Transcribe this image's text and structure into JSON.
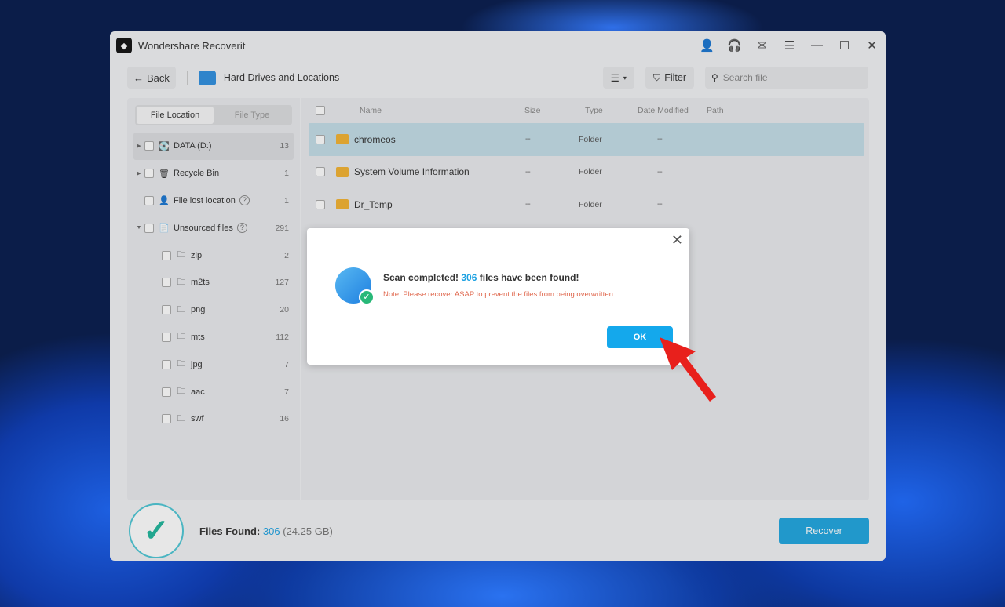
{
  "window": {
    "title": "Wondershare Recoverit"
  },
  "toolbar": {
    "back": "Back",
    "location": "Hard Drives and Locations",
    "filter": "Filter",
    "search_placeholder": "Search file"
  },
  "tabs": {
    "file_location": "File Location",
    "file_type": "File Type"
  },
  "tree": [
    {
      "label": "DATA (D:)",
      "count": "13"
    },
    {
      "label": "Recycle Bin",
      "count": "1"
    },
    {
      "label": "File lost location",
      "count": "1"
    },
    {
      "label": "Unsourced files",
      "count": "291"
    },
    {
      "label": "zip",
      "count": "2"
    },
    {
      "label": "m2ts",
      "count": "127"
    },
    {
      "label": "png",
      "count": "20"
    },
    {
      "label": "mts",
      "count": "112"
    },
    {
      "label": "jpg",
      "count": "7"
    },
    {
      "label": "aac",
      "count": "7"
    },
    {
      "label": "swf",
      "count": "16"
    }
  ],
  "table": {
    "headers": {
      "name": "Name",
      "size": "Size",
      "type": "Type",
      "date": "Date Modified",
      "path": "Path"
    },
    "rows": [
      {
        "name": "chromeos",
        "size": "--",
        "type": "Folder",
        "date": "--"
      },
      {
        "name": "System Volume Information",
        "size": "--",
        "type": "Folder",
        "date": "--"
      },
      {
        "name": "Dr_Temp",
        "size": "--",
        "type": "Folder",
        "date": "--"
      }
    ]
  },
  "footer": {
    "label": "Files Found:",
    "count": "306",
    "size": "(24.25 GB)",
    "recover": "Recover"
  },
  "dialog": {
    "title_pre": "Scan completed!",
    "count": "306",
    "title_post": "files have been found!",
    "note": "Note: Please recover ASAP to prevent the files from being overwritten.",
    "ok": "OK"
  },
  "colors": {
    "accent": "#1ea5e0",
    "note": "#e0694f",
    "annotation": "#e8201c"
  }
}
